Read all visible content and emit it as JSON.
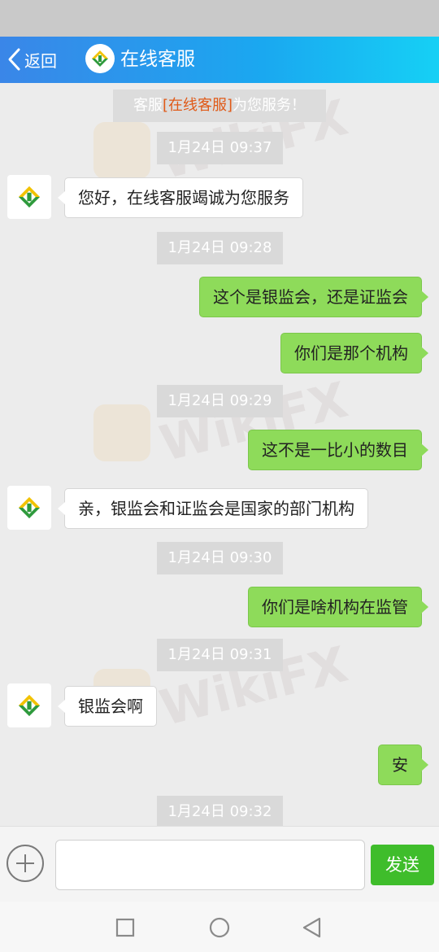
{
  "header": {
    "back_label": "返回",
    "title": "在线客服",
    "logo_icon": "service-logo-icon"
  },
  "notice": {
    "prefix": "客服",
    "highlight": "[在线客服]",
    "suffix": "为您服务！"
  },
  "messages": [
    {
      "type": "time",
      "text": "1月24日 09:37"
    },
    {
      "type": "left",
      "text": "您好，在线客服竭诚为您服务"
    },
    {
      "type": "time",
      "text": "1月24日 09:28"
    },
    {
      "type": "right",
      "text": "这个是银监会，还是证监会"
    },
    {
      "type": "right",
      "text": "你们是那个机构"
    },
    {
      "type": "time",
      "text": "1月24日 09:29"
    },
    {
      "type": "right",
      "text": "这不是一比小的数目"
    },
    {
      "type": "left",
      "text": "亲，银监会和证监会是国家的部门机构"
    },
    {
      "type": "time",
      "text": "1月24日 09:30"
    },
    {
      "type": "right",
      "text": "你们是啥机构在监管"
    },
    {
      "type": "time",
      "text": "1月24日 09:31"
    },
    {
      "type": "left",
      "text": "银监会啊"
    },
    {
      "type": "right",
      "text": "安"
    },
    {
      "type": "time",
      "text": "1月24日 09:32"
    }
  ],
  "input": {
    "value": "",
    "placeholder": "",
    "send_label": "发送"
  },
  "watermark": "WikiFX",
  "colors": {
    "header_start": "#3a86e8",
    "header_end": "#16d0f5",
    "bubble_right": "#8edb5a",
    "send_button": "#3fbd2b",
    "notice_highlight": "#e05a18"
  }
}
